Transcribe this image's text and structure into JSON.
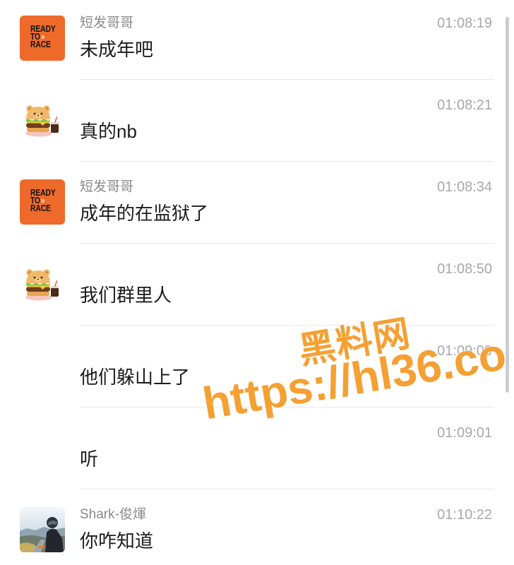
{
  "colors": {
    "background": "#ffffff",
    "sender": "#8a8a8a",
    "time": "#a8a8a8",
    "text": "#1b1b1b",
    "divider": "#e7e7e7",
    "scrollbar": "#cdcdcd",
    "ktm_orange": "#ee6a2a",
    "watermark": "#f5a033"
  },
  "avatars": {
    "ktm": {
      "icon": "ready-to-race-logo",
      "line1": "READY",
      "line2": "TO",
      "arrows": "»",
      "line3": "RACE"
    },
    "bear": {
      "icon": "bear-burger-sticker"
    },
    "shark": {
      "icon": "motorcycle-rider-photo"
    }
  },
  "messages": [
    {
      "sender": "短发哥哥",
      "time": "01:08:19",
      "text": "未成年吧",
      "avatar": "ktm"
    },
    {
      "time": "01:08:21",
      "text": "真的nb",
      "avatar": "bear"
    },
    {
      "sender": "短发哥哥",
      "time": "01:08:34",
      "text": "成年的在监狱了",
      "avatar": "ktm"
    },
    {
      "time": "01:08:50",
      "text": "我们群里人",
      "avatar": "bear"
    },
    {
      "time": "01:09:00",
      "text": "他们躲山上了"
    },
    {
      "time": "01:09:01",
      "text": "听"
    },
    {
      "sender": "Shark-俊煇",
      "time": "01:10:22",
      "text": "你咋知道",
      "avatar": "shark"
    }
  ],
  "watermark": {
    "site_name": "黑料网",
    "url": "https://hl36.co"
  }
}
